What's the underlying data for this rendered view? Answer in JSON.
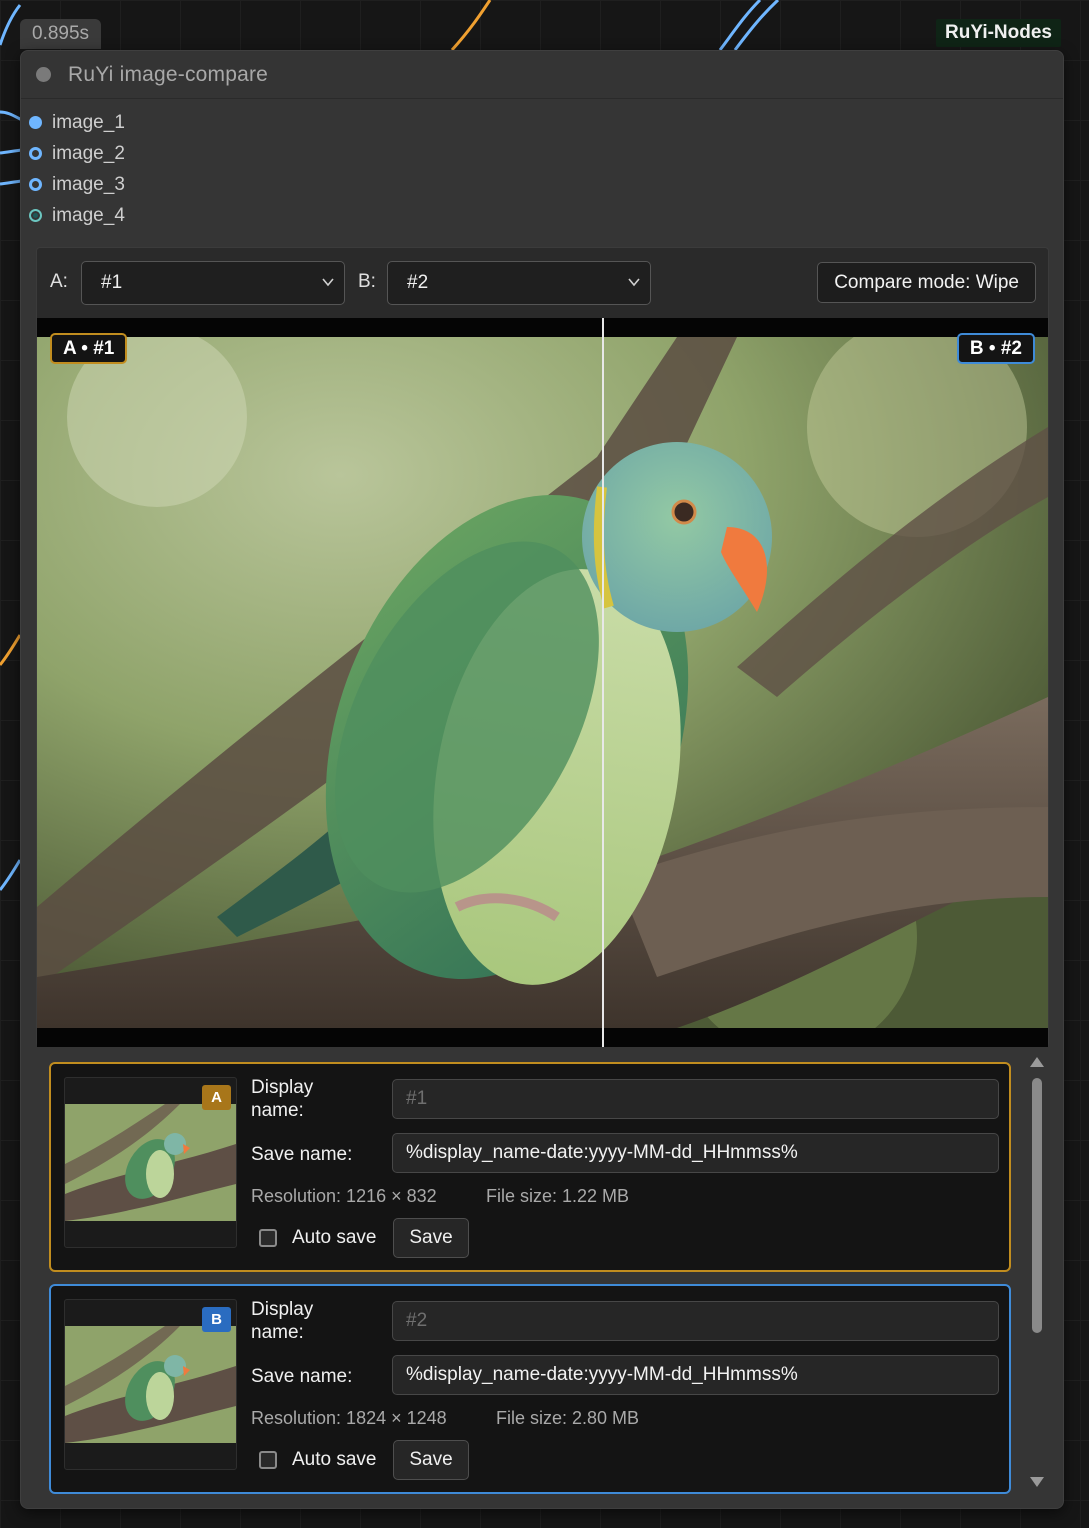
{
  "canvas": {
    "timing": "0.895s",
    "brand": "RuYi-Nodes"
  },
  "node": {
    "title": "RuYi image-compare",
    "inputs": [
      {
        "label": "image_1",
        "icon": "filled-slot-icon"
      },
      {
        "label": "image_2",
        "icon": "ring-slot-icon"
      },
      {
        "label": "image_3",
        "icon": "ring-slot-icon"
      },
      {
        "label": "image_4",
        "icon": "teal-slot-icon"
      }
    ]
  },
  "compare": {
    "a_label": "A:",
    "b_label": "B:",
    "a_selected": "#1",
    "b_selected": "#2",
    "mode_button": "Compare mode: Wipe",
    "tag_a": "A • #1",
    "tag_b": "B • #2",
    "wipe_position": 0.56
  },
  "cards": [
    {
      "badge": "A",
      "display_name_label": "Display name:",
      "display_name_placeholder": "#1",
      "save_name_label": "Save name:",
      "save_name_value": "%display_name-date:yyyy-MM-dd_HHmmss%",
      "resolution": "Resolution: 1216 × 832",
      "file_size": "File size: 1.22 MB",
      "auto_save_label": "Auto save",
      "auto_save_checked": false,
      "save_button": "Save"
    },
    {
      "badge": "B",
      "display_name_label": "Display name:",
      "display_name_placeholder": "#2",
      "save_name_label": "Save name:",
      "save_name_value": "%display_name-date:yyyy-MM-dd_HHmmss%",
      "resolution": "Resolution: 1824 × 1248",
      "file_size": "File size: 2.80 MB",
      "auto_save_label": "Auto save",
      "auto_save_checked": false,
      "save_button": "Save"
    }
  ],
  "colors": {
    "accent_a": "#c18d1f",
    "accent_b": "#3f8bd8",
    "slot_blue": "#6fb6ff",
    "wire_orange": "#f0a030"
  }
}
